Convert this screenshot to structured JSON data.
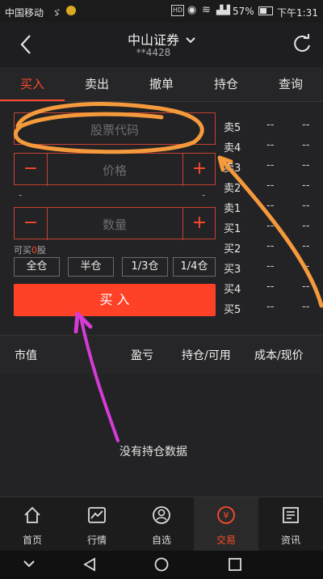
{
  "status_bar": {
    "carrier": "中国移动",
    "battery": "57%",
    "time": "下午1:31"
  },
  "header": {
    "title": "中山证券",
    "account": "**4428"
  },
  "tabs": [
    "买入",
    "卖出",
    "撤单",
    "持仓",
    "查询"
  ],
  "form": {
    "stock_code_placeholder": "股票代码",
    "price_placeholder": "价格",
    "quantity_placeholder": "数量",
    "minus": "−",
    "plus": "+",
    "price_range_left": "-",
    "price_range_right": "-",
    "can_buy_prefix": "可买",
    "can_buy_value": "0",
    "can_buy_suffix": "股",
    "quick_buttons": [
      "全仓",
      "半仓",
      "1/3仓",
      "1/4仓"
    ],
    "buy_button": "买 入"
  },
  "order_book": {
    "levels": [
      "卖5",
      "卖4",
      "卖3",
      "卖2",
      "卖1",
      "买1",
      "买2",
      "买3",
      "买4",
      "买5"
    ],
    "price": "--",
    "volume": "--"
  },
  "holdings": {
    "columns": [
      "市值",
      "盈亏",
      "持仓/可用",
      "成本/现价"
    ],
    "empty_text": "没有持仓数据"
  },
  "bottom_nav": {
    "items": [
      {
        "label": "首页",
        "icon": "home-icon"
      },
      {
        "label": "行情",
        "icon": "chart-icon"
      },
      {
        "label": "自选",
        "icon": "watchlist-icon"
      },
      {
        "label": "交易",
        "icon": "trade-icon"
      },
      {
        "label": "资讯",
        "icon": "news-icon"
      }
    ],
    "active": "交易"
  },
  "colors": {
    "accent": "#ff4a2b",
    "annotation_orange": "#f59a3c",
    "annotation_magenta": "#d63bd6"
  }
}
